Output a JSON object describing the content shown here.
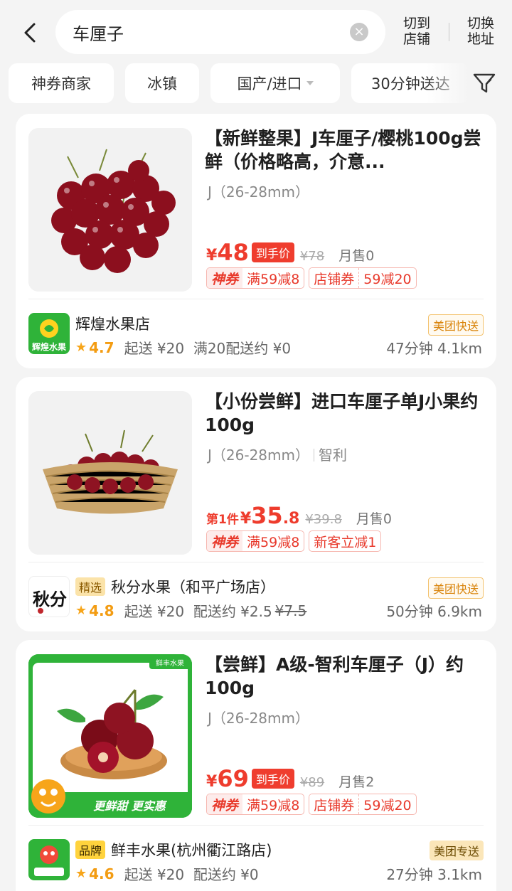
{
  "header": {
    "search_value": "车厘子",
    "switch_store": [
      "切到",
      "店铺"
    ],
    "switch_address": [
      "切换",
      "地址"
    ]
  },
  "filters": [
    {
      "label": "神券商家"
    },
    {
      "label": "冰镇"
    },
    {
      "label": "国产/进口"
    },
    {
      "label": "30分钟送达"
    }
  ],
  "products": [
    {
      "title": "【新鲜整果】J车厘子/樱桃100g尝鲜（价格略高，介意...",
      "spec": "J（26-28mm）",
      "spec_extra": "",
      "price_prefix": "",
      "currency": "¥",
      "price_int": "48",
      "price_dec": "",
      "price_tag": "到手价",
      "orig_price": "¥78",
      "sold": "月售0",
      "coupons": [
        {
          "label": "神券",
          "value": "满59减8",
          "style": "god"
        },
        {
          "label": "店铺券",
          "value": "59减20",
          "style": "plain"
        }
      ],
      "shop": {
        "badge": "",
        "name": "辉煌水果店",
        "delivery": "美团快送",
        "rating": "4.7",
        "min_order": "起送 ¥20",
        "fee": "满20配送约 ¥0",
        "fee_strike": "",
        "time_dist": "47分钟  4.1km"
      }
    },
    {
      "title": "【小份尝鲜】进口车厘子单J小果约100g",
      "spec": "J（26-28mm）",
      "spec_extra": "智利",
      "price_prefix": "第1件",
      "currency": "¥",
      "price_int": "35",
      "price_dec": ".8",
      "price_tag": "",
      "orig_price": "¥39.8",
      "sold": "月售0",
      "coupons": [
        {
          "label": "神券",
          "value": "满59减8",
          "style": "god"
        },
        {
          "label": "",
          "value": "新客立减1",
          "style": "single"
        }
      ],
      "shop": {
        "badge": "精选",
        "name": "秋分水果（和平广场店）",
        "delivery": "美团快送",
        "rating": "4.8",
        "min_order": "起送 ¥20",
        "fee": "配送约 ¥2.5",
        "fee_strike": "¥7.5",
        "time_dist": "50分钟  6.9km"
      }
    },
    {
      "title": "【尝鲜】A级-智利车厘子（J）约100g",
      "spec": "J（26-28mm）",
      "spec_extra": "",
      "price_prefix": "",
      "currency": "¥",
      "price_int": "69",
      "price_dec": "",
      "price_tag": "到手价",
      "orig_price": "¥89",
      "sold": "月售2",
      "coupons": [
        {
          "label": "神券",
          "value": "满59减8",
          "style": "god"
        },
        {
          "label": "店铺券",
          "value": "59减20",
          "style": "plain"
        }
      ],
      "shop": {
        "badge": "品牌",
        "name": "鲜丰水果(杭州衢江路店)",
        "delivery": "美团专送",
        "rating": "4.6",
        "min_order": "起送 ¥20",
        "fee": "配送约 ¥0",
        "fee_strike": "",
        "time_dist": "27分钟  3.1km"
      }
    }
  ],
  "image_text": {
    "p1_logo": "辉煌水果",
    "p2_logo": "秋分",
    "p3_corner": "鲜丰水果",
    "p3_slogan": "更鲜甜 更实惠"
  },
  "colors": {
    "accent_red": "#ee3c2d",
    "rating_orange": "#f39c12",
    "background": "#f4f4f4",
    "brand_green": "#2fb339"
  },
  "icons": [
    "back-arrow-icon",
    "clear-icon",
    "filter-funnel-icon",
    "star-icon",
    "chevron-down-icon"
  ]
}
